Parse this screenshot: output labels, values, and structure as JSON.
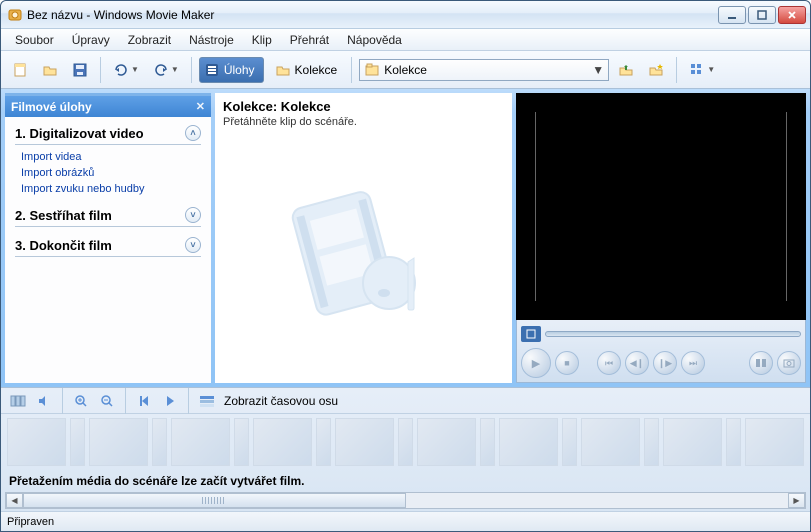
{
  "window": {
    "title": "Bez názvu - Windows Movie Maker"
  },
  "menubar": {
    "items": [
      "Soubor",
      "Úpravy",
      "Zobrazit",
      "Nástroje",
      "Klip",
      "Přehrát",
      "Nápověda"
    ]
  },
  "toolbar": {
    "tasks_toggle_label": "Úlohy",
    "collections_label": "Kolekce",
    "location_combo": "Kolekce"
  },
  "tasks": {
    "header": "Filmové úlohy",
    "groups": [
      {
        "title": "1. Digitalizovat video",
        "expanded": true,
        "links": [
          "Import videa",
          "Import obrázků",
          "Import zvuku nebo hudby"
        ]
      },
      {
        "title": "2. Sestříhat film",
        "expanded": false,
        "links": []
      },
      {
        "title": "3. Dokončit film",
        "expanded": false,
        "links": []
      }
    ]
  },
  "collection": {
    "title": "Kolekce: Kolekce",
    "subtitle": "Přetáhněte klip do scénáře."
  },
  "storyboard": {
    "timeline_label": "Zobrazit časovou osu",
    "hint": "Přetažením média do scénáře lze začít vytvářet film."
  },
  "statusbar": {
    "text": "Připraven"
  }
}
